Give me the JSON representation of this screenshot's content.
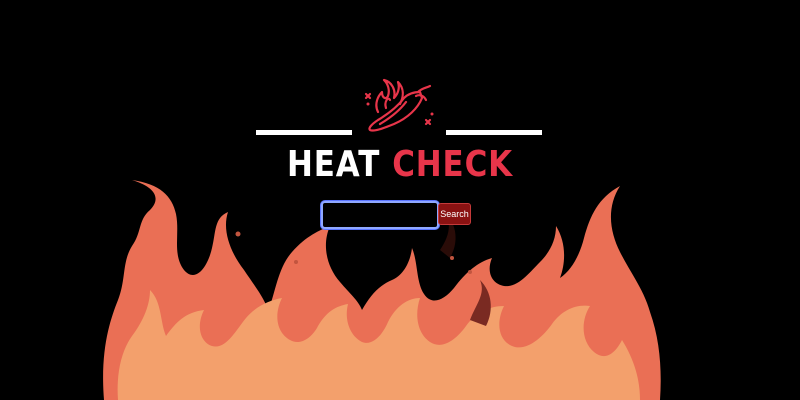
{
  "app": {
    "title_word1": "HEAT",
    "title_word2": "CHECK",
    "logo_icon": "chili-pepper-flame-icon"
  },
  "search": {
    "value": "",
    "placeholder": "",
    "button_label": "Search"
  },
  "colors": {
    "background": "#000000",
    "accent_red": "#e8354a",
    "button_bg": "#8a1212",
    "input_focus_border": "#8fa8ff",
    "flame_outer": "#ea6f55",
    "flame_inner": "#f3a06c"
  }
}
